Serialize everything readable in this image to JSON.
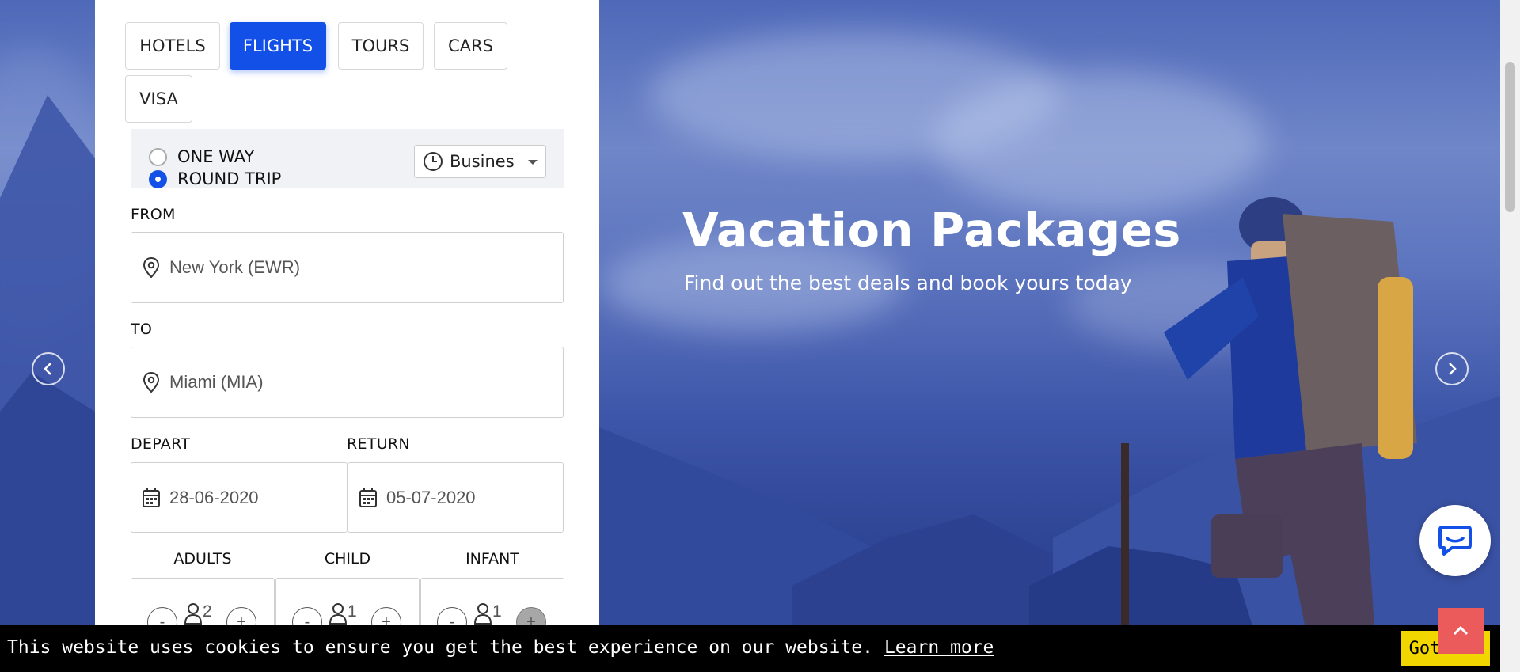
{
  "tabs": [
    {
      "label": "HOTELS",
      "active": false
    },
    {
      "label": "FLIGHTS",
      "active": true
    },
    {
      "label": "TOURS",
      "active": false
    },
    {
      "label": "CARS",
      "active": false
    },
    {
      "label": "VISA",
      "active": false
    }
  ],
  "trip_type": {
    "one_way_label": "ONE WAY",
    "round_trip_label": "ROUND TRIP",
    "selected": "ROUND TRIP"
  },
  "cabin_class": {
    "value": "Busines"
  },
  "from": {
    "label": "FROM",
    "value": "New York (EWR)"
  },
  "to": {
    "label": "TO",
    "value": "Miami (MIA)"
  },
  "depart": {
    "label": "DEPART",
    "value": "28-06-2020"
  },
  "return": {
    "label": "RETURN",
    "value": "05-07-2020"
  },
  "passengers": {
    "adults": {
      "label": "ADULTS",
      "count": "2"
    },
    "child": {
      "label": "CHILD",
      "count": "1"
    },
    "infant": {
      "label": "INFANT",
      "count": "1"
    },
    "minus": "-",
    "plus": "+"
  },
  "hero": {
    "title": "Vacation Packages",
    "subtitle": "Find out the best deals and book yours today"
  },
  "cookie": {
    "text": "This website uses cookies to ensure you get the best experience on our website.",
    "learn_more": "Learn more",
    "got_it": "Got it!"
  },
  "colors": {
    "accent": "#1250e8",
    "cookie_button": "#f1d600",
    "scroll_top": "#ec5b5b"
  }
}
